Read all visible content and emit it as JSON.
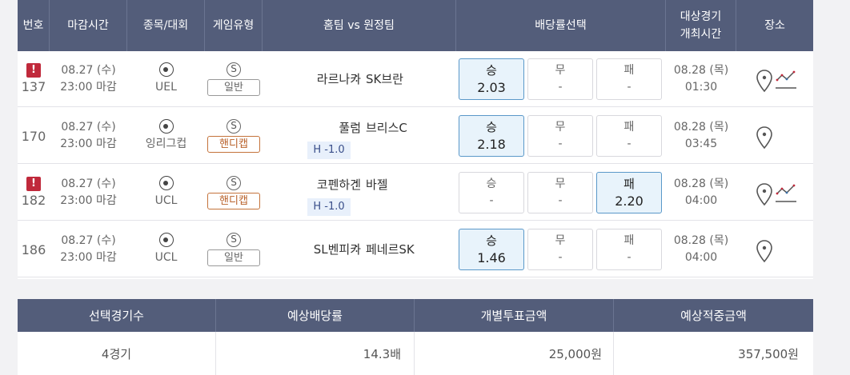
{
  "header": {
    "no": "번호",
    "deadline": "마감시간",
    "sport": "종목/대회",
    "game_type": "게임유형",
    "teams": "홈팀 vs 원정팀",
    "odds_select": "배당률선택",
    "match_time_line1": "대상경기",
    "match_time_line2": "개최시간",
    "venue": "장소"
  },
  "rows": [
    {
      "alert": "!",
      "no": "137",
      "date": "08.27 (수)",
      "close": "23:00 마감",
      "league": "UEL",
      "s_badge": "S",
      "type": "일반",
      "home": "라르나카",
      "colon": ":",
      "away": "SK브란",
      "handicap": "",
      "win_label": "승",
      "win_val": "2.03",
      "draw_label": "무",
      "draw_val": "-",
      "lose_label": "패",
      "lose_val": "-",
      "selected": "win",
      "match_date": "08.28 (목)",
      "match_time": "01:30",
      "trend": true
    },
    {
      "alert": "",
      "no": "170",
      "date": "08.27 (수)",
      "close": "23:00 마감",
      "league": "잉리그컵",
      "s_badge": "S",
      "type": "핸디캡",
      "home": "풀럼",
      "colon": ":",
      "away": "브리스C",
      "handicap": "H -1.0",
      "win_label": "승",
      "win_val": "2.18",
      "draw_label": "무",
      "draw_val": "-",
      "lose_label": "패",
      "lose_val": "-",
      "selected": "win",
      "match_date": "08.28 (목)",
      "match_time": "03:45",
      "trend": false
    },
    {
      "alert": "!",
      "no": "182",
      "date": "08.27 (수)",
      "close": "23:00 마감",
      "league": "UCL",
      "s_badge": "S",
      "type": "핸디캡",
      "home": "코펜하겐",
      "colon": ":",
      "away": "바젤",
      "handicap": "H -1.0",
      "win_label": "승",
      "win_val": "-",
      "draw_label": "무",
      "draw_val": "-",
      "lose_label": "패",
      "lose_val": "2.20",
      "selected": "lose",
      "match_date": "08.28 (목)",
      "match_time": "04:00",
      "trend": true
    },
    {
      "alert": "",
      "no": "186",
      "date": "08.27 (수)",
      "close": "23:00 마감",
      "league": "UCL",
      "s_badge": "S",
      "type": "일반",
      "home": "SL벤피카",
      "colon": ":",
      "away": "페네르SK",
      "handicap": "",
      "win_label": "승",
      "win_val": "1.46",
      "draw_label": "무",
      "draw_val": "-",
      "lose_label": "패",
      "lose_val": "-",
      "selected": "win",
      "match_date": "08.28 (목)",
      "match_time": "04:00",
      "trend": false
    }
  ],
  "summary": {
    "h_count": "선택경기수",
    "h_odds": "예상배당률",
    "h_stake": "개별투표금액",
    "h_payout": "예상적중금액",
    "count": "4경기",
    "odds": "14.3배",
    "stake": "25,000원",
    "payout": "357,500원"
  },
  "colors": {
    "header_bg": "#535d7a",
    "alert": "#c0293b",
    "selected_bg": "#e8f3fb",
    "selected_border": "#5a98c9",
    "handicap": "#c4733b",
    "handicap_line_bg": "#e8f0fb"
  },
  "icons": {
    "alert": "alert-icon",
    "sport": "soccer-ball-icon",
    "special": "s-badge-icon",
    "venue": "location-pin-icon",
    "trend": "trend-chart-icon"
  }
}
